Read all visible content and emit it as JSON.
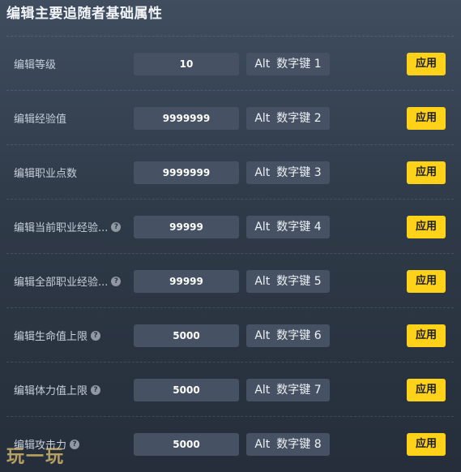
{
  "header": {
    "title": "编辑主要追随者基础属性"
  },
  "rows": [
    {
      "label": "编辑等级",
      "value": "10",
      "has_help": false,
      "hotkey_mod": "Alt",
      "hotkey_key": "数字键 1",
      "apply_label": "应用"
    },
    {
      "label": "编辑经验值",
      "value": "9999999",
      "has_help": false,
      "hotkey_mod": "Alt",
      "hotkey_key": "数字键 2",
      "apply_label": "应用"
    },
    {
      "label": "编辑职业点数",
      "value": "9999999",
      "has_help": false,
      "hotkey_mod": "Alt",
      "hotkey_key": "数字键 3",
      "apply_label": "应用"
    },
    {
      "label": "编辑当前职业经验...",
      "value": "99999",
      "has_help": true,
      "hotkey_mod": "Alt",
      "hotkey_key": "数字键 4",
      "apply_label": "应用"
    },
    {
      "label": "编辑全部职业经验...",
      "value": "99999",
      "has_help": true,
      "hotkey_mod": "Alt",
      "hotkey_key": "数字键 5",
      "apply_label": "应用"
    },
    {
      "label": "编辑生命值上限",
      "value": "5000",
      "has_help": true,
      "hotkey_mod": "Alt",
      "hotkey_key": "数字键 6",
      "apply_label": "应用"
    },
    {
      "label": "编辑体力值上限",
      "value": "5000",
      "has_help": true,
      "hotkey_mod": "Alt",
      "hotkey_key": "数字键 7",
      "apply_label": "应用"
    },
    {
      "label": "编辑攻击力",
      "value": "5000",
      "has_help": true,
      "hotkey_mod": "Alt",
      "hotkey_key": "数字键 8",
      "apply_label": "应用"
    }
  ],
  "help_glyph": "?",
  "watermark": "玩一玩",
  "colors": {
    "apply_bg": "#ffd21a",
    "field_bg": "#465263",
    "panel_bg": "#2f3a48"
  }
}
